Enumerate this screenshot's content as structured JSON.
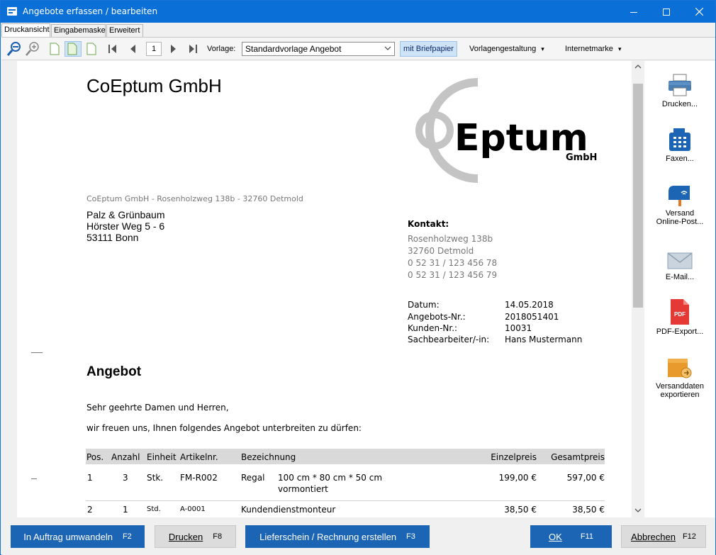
{
  "window": {
    "title": "Angebote erfassen / bearbeiten",
    "accent": "#0a6fd6"
  },
  "tabs": [
    {
      "label": "Druckansicht",
      "active": true
    },
    {
      "label": "Eingabemaske",
      "active": false
    },
    {
      "label": "Erweitert",
      "active": false
    }
  ],
  "toolbar": {
    "page_number": "1",
    "vorlage_label": "Vorlage:",
    "vorlage_value": "Standardvorlage Angebot",
    "briefpapier_label": "mit Briefpapier",
    "vorlagengestaltung_label": "Vorlagengestaltung",
    "internetmarke_label": "Internetmarke",
    "dropdown_glyph": "▾"
  },
  "document": {
    "company_name": "CoEptum GmbH",
    "logo": {
      "text_main": "Eptum",
      "text_sub": "GmbH"
    },
    "sender_line": "CoEptum GmbH - Rosenholzweg 138b - 32760 Detmold",
    "recipient": [
      "Palz & Grünbaum",
      "Hörster Weg 5 - 6",
      "53111 Bonn"
    ],
    "contact_heading": "Kontakt:",
    "contact_lines": [
      "Rosenholzweg 138b",
      "32760 Detmold",
      "0 52 31 / 123 456 78",
      "0 52 31 / 123 456 79"
    ],
    "meta": [
      {
        "key": "Datum:",
        "value": "14.05.2018"
      },
      {
        "key": "Angebots-Nr.:",
        "value": "2018051401"
      },
      {
        "key": "Kunden-Nr.:",
        "value": "10031"
      },
      {
        "key": "Sachbearbeiter/-in:",
        "value": "Hans Mustermann"
      }
    ],
    "heading": "Angebot",
    "salutation": "Sehr geehrte Damen und Herren,",
    "intro": "wir freuen uns, Ihnen folgendes Angebot unterbreiten zu dürfen:",
    "table": {
      "headers": {
        "pos": "Pos.",
        "anzahl": "Anzahl",
        "einheit": "Einheit",
        "artikelnr": "Artikelnr.",
        "bezeichnung": "Bezeichnung",
        "einzelpreis": "Einzelpreis",
        "gesamtpreis": "Gesamtpreis"
      },
      "rows": [
        {
          "pos": "1",
          "anzahl": "3",
          "einheit": "Stk.",
          "artikelnr": "FM-R002",
          "bezeichnung": "Regal",
          "detail": "100 cm * 80 cm * 50 cm",
          "detail2": "vormontiert",
          "einzelpreis": "199,00 €",
          "gesamtpreis": "597,00 €"
        },
        {
          "pos": "2",
          "anzahl": "1",
          "einheit": "Std.",
          "artikelnr": "A-0001",
          "bezeichnung": "Kundendienstmonteur",
          "detail": "",
          "detail2": "",
          "einzelpreis": "38,50 €",
          "gesamtpreis": "38,50 €"
        }
      ]
    }
  },
  "sidebar": [
    {
      "label": "Drucken...",
      "icon": "printer-icon"
    },
    {
      "label": "Faxen...",
      "icon": "fax-icon"
    },
    {
      "label": "Versand Online-Post...",
      "line1": "Versand",
      "line2": "Online-Post...",
      "icon": "mailbox-icon"
    },
    {
      "label": "E-Mail...",
      "icon": "envelope-icon"
    },
    {
      "label": "PDF-Export...",
      "icon": "pdf-icon",
      "badge": "PDF"
    },
    {
      "label": "Versanddaten exportieren",
      "line1": "Versanddaten",
      "line2": "exportieren",
      "icon": "box-export-icon"
    }
  ],
  "bottom": {
    "auftrag": {
      "label": "In Auftrag umwandeln",
      "key": "F2"
    },
    "drucken": {
      "label": "Drucken",
      "key": "F8"
    },
    "lieferschein": {
      "label": "Lieferschein / Rechnung erstellen",
      "key": "F3"
    },
    "ok": {
      "label": "OK",
      "key": "F11"
    },
    "abbrechen": {
      "label": "Abbrechen",
      "key": "F12"
    }
  }
}
